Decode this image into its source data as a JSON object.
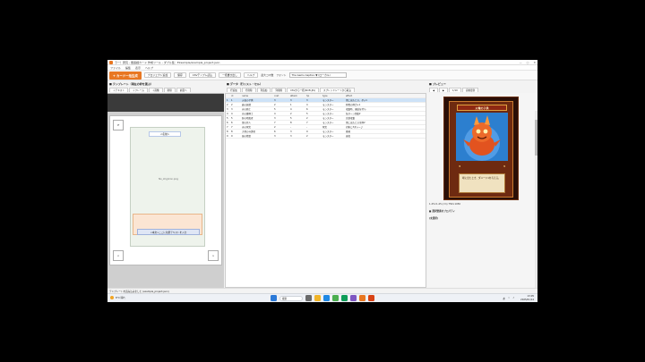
{
  "window": {
    "title": "ラー！研究 - 闇遊戯カード 作成ツール - ダブル集：Eksample/example_project.json",
    "min": "—",
    "max": "▢",
    "close": "✕"
  },
  "menu": [
    "ファイル",
    "編集",
    "表示",
    "ヘルプ"
  ],
  "toolbar": {
    "primary": "+ カード一括生成",
    "buttons": [
      "プロジェクト追加",
      "保存",
      "CSVテンプレ読込",
      "一括書き出し",
      "ヘルプ"
    ],
    "label1": "最大コマ数",
    "label2": "フォント",
    "font_value": "The Gems Caption ▼ (ローカル)"
  },
  "panels": {
    "template_header": "■ テンプレート（現在の枠を選ぶ）",
    "template_tabs": [
      "＋テキスト",
      "＋フレーム",
      "＋画像",
      "削除",
      "前面へ"
    ],
    "data_header": "■ データ（行リスト・セル）",
    "data_tabs": [
      "行追加",
      "行削除",
      "列追加",
      "列削除",
      "CSVから一括(Shift-JIS)",
      "スプレッドシートから取込"
    ],
    "preview_header": "■ プレビュー",
    "preview_controls": [
      "◀",
      "▶",
      "1/10",
      "自動更新"
    ],
    "props_header": "■ 選択要素のプロパティ",
    "props_empty": "(未選択)"
  },
  "template": {
    "name_field": "<名前>",
    "no_image": "No_img/icon.png",
    "text_field": "<本文>ここに効果テキストを入力",
    "btn_top": "⟳",
    "btn_bottom_left": "<",
    "btn_bottom_right": ">"
  },
  "table": {
    "headers": [
      "",
      "id",
      "name",
      "cost",
      "attack",
      "hp",
      "type",
      "effect"
    ],
    "rows": [
      [
        "1",
        "1",
        "火竜の子供",
        "3",
        "3",
        "3",
        "モンスター",
        "場に出たとき、ダメ1"
      ],
      [
        "2",
        "2",
        "森の妖精",
        "2",
        "1",
        "4",
        "モンスター",
        "仲間の体力+1"
      ],
      [
        "3",
        "3",
        "氷の騎士",
        "5",
        "4",
        "6",
        "モンスター",
        "攻撃時、凍結を付与"
      ],
      [
        "4",
        "4",
        "光の魔導士",
        "4",
        "2",
        "5",
        "モンスター",
        "毎ターン回復2"
      ],
      [
        "5",
        "5",
        "影の暗殺者",
        "3",
        "5",
        "2",
        "モンスター",
        "先制攻撃"
      ],
      [
        "6",
        "6",
        "雷の巨人",
        "7",
        "8",
        "7",
        "モンスター",
        "場に出たとき全体2"
      ],
      [
        "7",
        "7",
        "炎の呪文",
        "2",
        "-",
        "-",
        "呪文",
        "対象に3ダメージ"
      ],
      [
        "8",
        "8",
        "大地の守護者",
        "6",
        "3",
        "9",
        "モンスター",
        "挑発"
      ],
      [
        "9",
        "9",
        "風の精霊",
        "3",
        "3",
        "2",
        "モンスター",
        "速攻"
      ]
    ]
  },
  "preview": {
    "card_title": "火竜の子供",
    "card_attack": "3",
    "card_hp": "3",
    "card_text": "場に出たとき、ダメージ1を与える。",
    "size_info": "1.25×1.45 (cm)  750×1050"
  },
  "status": {
    "text": "テンプレートを読み込みました (example_project.json)"
  },
  "taskbar": {
    "weather": "8°C 晴れ",
    "search": "検索",
    "time": "13:05",
    "date": "2025/01/14",
    "lang": "あ"
  },
  "colors": {
    "accent": "#e87722",
    "selection": "#cde2f7"
  }
}
